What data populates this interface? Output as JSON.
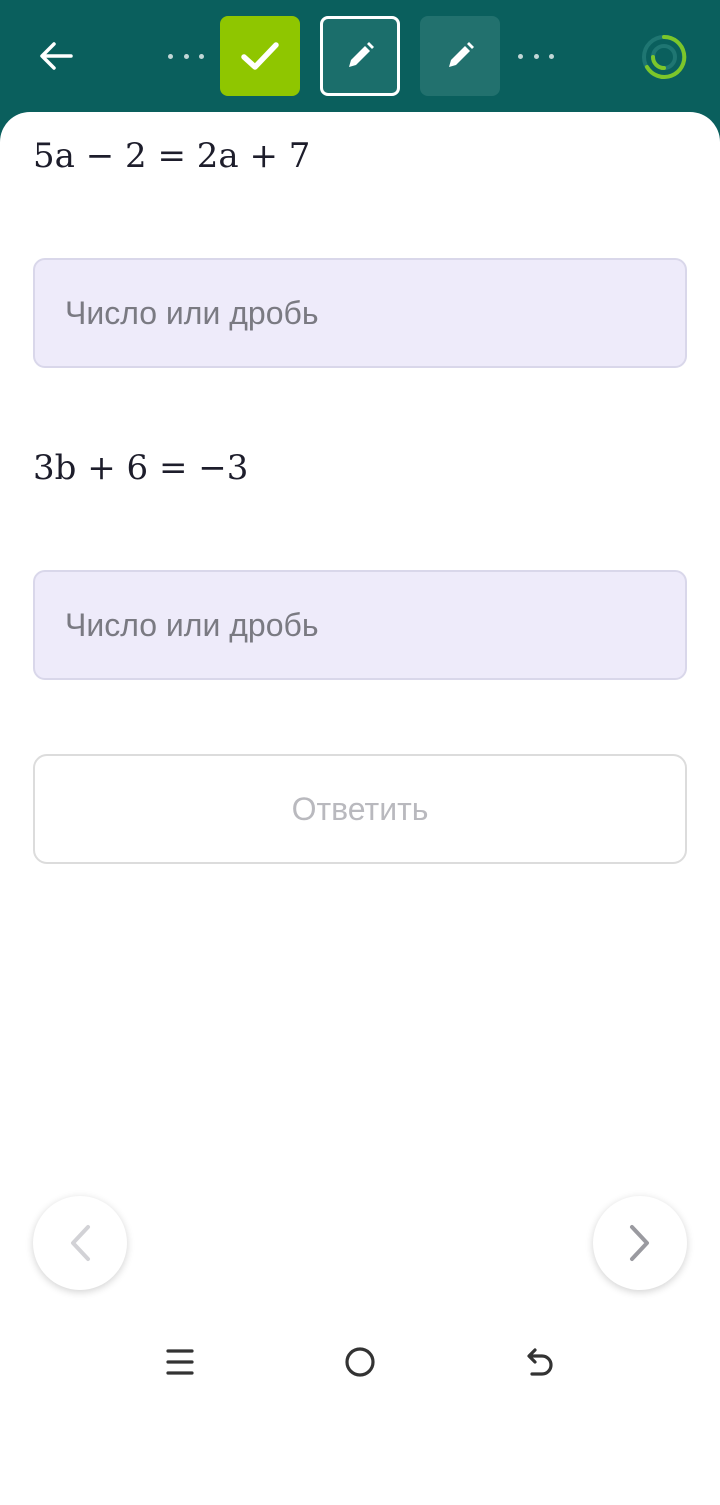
{
  "header": {
    "back_icon": "arrow-left-icon",
    "steps": [
      {
        "state": "done",
        "icon": "checkmark-icon",
        "color": "#8fc600"
      },
      {
        "state": "current",
        "icon": "pencil-icon",
        "color": "#ffffff"
      },
      {
        "state": "pending",
        "icon": "pencil-icon",
        "color": "#22716e"
      }
    ],
    "progress_icon": "progress-ring-icon",
    "colors": {
      "bar": "#0a5f5d",
      "accent": "#8fc600"
    }
  },
  "tasks": [
    {
      "equation": "5a − 2 = 2a + 7",
      "answer_placeholder": "Число или дробь",
      "answer_value": ""
    },
    {
      "equation": "3b + 6 = −3",
      "answer_placeholder": "Число или дробь",
      "answer_value": ""
    }
  ],
  "submit": {
    "label": "Ответить"
  },
  "navigation": {
    "prev_icon": "chevron-left-icon",
    "next_icon": "chevron-right-icon"
  },
  "system_bar": {
    "icons": [
      "menu-lines-icon",
      "home-circle-icon",
      "back-arrow-icon"
    ]
  }
}
